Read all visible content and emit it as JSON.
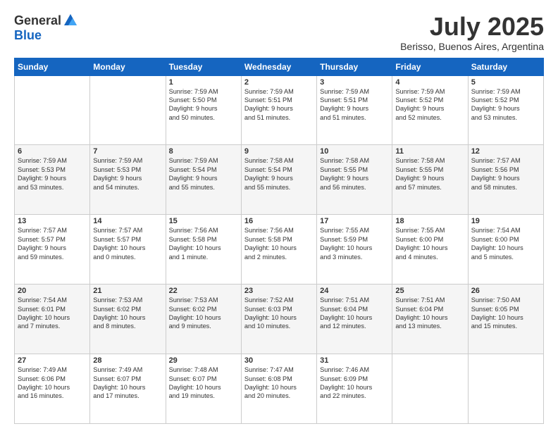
{
  "header": {
    "logo_general": "General",
    "logo_blue": "Blue",
    "month_year": "July 2025",
    "location": "Berisso, Buenos Aires, Argentina"
  },
  "days_of_week": [
    "Sunday",
    "Monday",
    "Tuesday",
    "Wednesday",
    "Thursday",
    "Friday",
    "Saturday"
  ],
  "weeks": [
    [
      {
        "day": "",
        "info": ""
      },
      {
        "day": "",
        "info": ""
      },
      {
        "day": "1",
        "info": "Sunrise: 7:59 AM\nSunset: 5:50 PM\nDaylight: 9 hours\nand 50 minutes."
      },
      {
        "day": "2",
        "info": "Sunrise: 7:59 AM\nSunset: 5:51 PM\nDaylight: 9 hours\nand 51 minutes."
      },
      {
        "day": "3",
        "info": "Sunrise: 7:59 AM\nSunset: 5:51 PM\nDaylight: 9 hours\nand 51 minutes."
      },
      {
        "day": "4",
        "info": "Sunrise: 7:59 AM\nSunset: 5:52 PM\nDaylight: 9 hours\nand 52 minutes."
      },
      {
        "day": "5",
        "info": "Sunrise: 7:59 AM\nSunset: 5:52 PM\nDaylight: 9 hours\nand 53 minutes."
      }
    ],
    [
      {
        "day": "6",
        "info": "Sunrise: 7:59 AM\nSunset: 5:53 PM\nDaylight: 9 hours\nand 53 minutes."
      },
      {
        "day": "7",
        "info": "Sunrise: 7:59 AM\nSunset: 5:53 PM\nDaylight: 9 hours\nand 54 minutes."
      },
      {
        "day": "8",
        "info": "Sunrise: 7:59 AM\nSunset: 5:54 PM\nDaylight: 9 hours\nand 55 minutes."
      },
      {
        "day": "9",
        "info": "Sunrise: 7:58 AM\nSunset: 5:54 PM\nDaylight: 9 hours\nand 55 minutes."
      },
      {
        "day": "10",
        "info": "Sunrise: 7:58 AM\nSunset: 5:55 PM\nDaylight: 9 hours\nand 56 minutes."
      },
      {
        "day": "11",
        "info": "Sunrise: 7:58 AM\nSunset: 5:55 PM\nDaylight: 9 hours\nand 57 minutes."
      },
      {
        "day": "12",
        "info": "Sunrise: 7:57 AM\nSunset: 5:56 PM\nDaylight: 9 hours\nand 58 minutes."
      }
    ],
    [
      {
        "day": "13",
        "info": "Sunrise: 7:57 AM\nSunset: 5:57 PM\nDaylight: 9 hours\nand 59 minutes."
      },
      {
        "day": "14",
        "info": "Sunrise: 7:57 AM\nSunset: 5:57 PM\nDaylight: 10 hours\nand 0 minutes."
      },
      {
        "day": "15",
        "info": "Sunrise: 7:56 AM\nSunset: 5:58 PM\nDaylight: 10 hours\nand 1 minute."
      },
      {
        "day": "16",
        "info": "Sunrise: 7:56 AM\nSunset: 5:58 PM\nDaylight: 10 hours\nand 2 minutes."
      },
      {
        "day": "17",
        "info": "Sunrise: 7:55 AM\nSunset: 5:59 PM\nDaylight: 10 hours\nand 3 minutes."
      },
      {
        "day": "18",
        "info": "Sunrise: 7:55 AM\nSunset: 6:00 PM\nDaylight: 10 hours\nand 4 minutes."
      },
      {
        "day": "19",
        "info": "Sunrise: 7:54 AM\nSunset: 6:00 PM\nDaylight: 10 hours\nand 5 minutes."
      }
    ],
    [
      {
        "day": "20",
        "info": "Sunrise: 7:54 AM\nSunset: 6:01 PM\nDaylight: 10 hours\nand 7 minutes."
      },
      {
        "day": "21",
        "info": "Sunrise: 7:53 AM\nSunset: 6:02 PM\nDaylight: 10 hours\nand 8 minutes."
      },
      {
        "day": "22",
        "info": "Sunrise: 7:53 AM\nSunset: 6:02 PM\nDaylight: 10 hours\nand 9 minutes."
      },
      {
        "day": "23",
        "info": "Sunrise: 7:52 AM\nSunset: 6:03 PM\nDaylight: 10 hours\nand 10 minutes."
      },
      {
        "day": "24",
        "info": "Sunrise: 7:51 AM\nSunset: 6:04 PM\nDaylight: 10 hours\nand 12 minutes."
      },
      {
        "day": "25",
        "info": "Sunrise: 7:51 AM\nSunset: 6:04 PM\nDaylight: 10 hours\nand 13 minutes."
      },
      {
        "day": "26",
        "info": "Sunrise: 7:50 AM\nSunset: 6:05 PM\nDaylight: 10 hours\nand 15 minutes."
      }
    ],
    [
      {
        "day": "27",
        "info": "Sunrise: 7:49 AM\nSunset: 6:06 PM\nDaylight: 10 hours\nand 16 minutes."
      },
      {
        "day": "28",
        "info": "Sunrise: 7:49 AM\nSunset: 6:07 PM\nDaylight: 10 hours\nand 17 minutes."
      },
      {
        "day": "29",
        "info": "Sunrise: 7:48 AM\nSunset: 6:07 PM\nDaylight: 10 hours\nand 19 minutes."
      },
      {
        "day": "30",
        "info": "Sunrise: 7:47 AM\nSunset: 6:08 PM\nDaylight: 10 hours\nand 20 minutes."
      },
      {
        "day": "31",
        "info": "Sunrise: 7:46 AM\nSunset: 6:09 PM\nDaylight: 10 hours\nand 22 minutes."
      },
      {
        "day": "",
        "info": ""
      },
      {
        "day": "",
        "info": ""
      }
    ]
  ]
}
